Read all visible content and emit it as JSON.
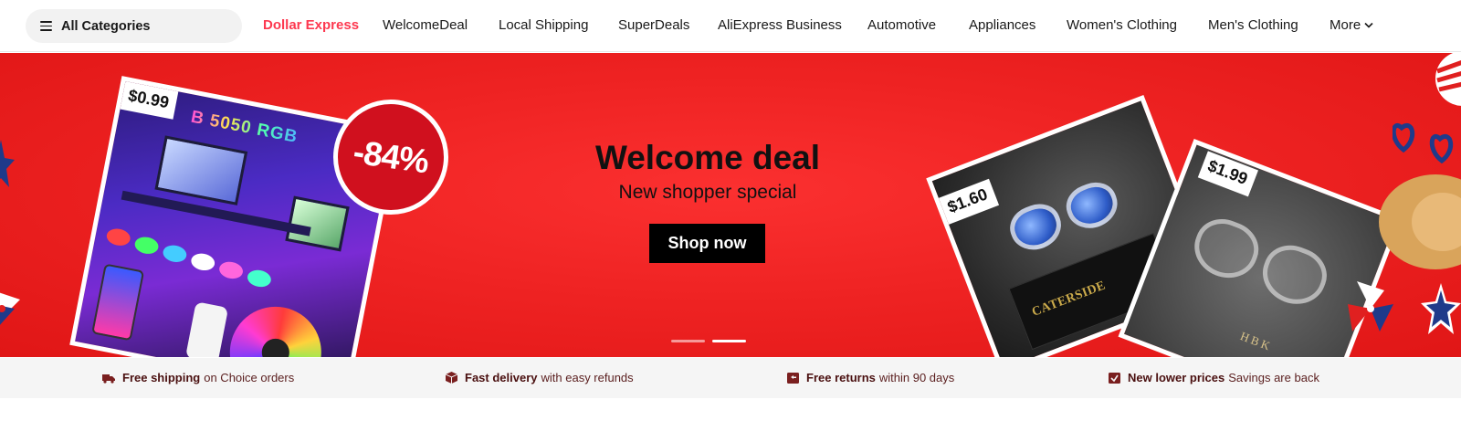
{
  "nav": {
    "categories_label": "All Categories",
    "items": [
      {
        "label": "Dollar Express",
        "highlight": true
      },
      {
        "label": "WelcomeDeal"
      },
      {
        "label": "Local Shipping"
      },
      {
        "label": "SuperDeals"
      },
      {
        "label": "AliExpress Business"
      },
      {
        "label": "Automotive"
      },
      {
        "label": "Appliances"
      },
      {
        "label": "Women's Clothing"
      },
      {
        "label": "Men's Clothing"
      }
    ],
    "more_label": "More",
    "highlight_color": "#fd384f"
  },
  "banner": {
    "title": "Welcome deal",
    "subtitle": "New shopper special",
    "cta_label": "Shop now",
    "background_color": "#ef2323",
    "slides_total": 2,
    "active_slide": 2,
    "products": [
      {
        "price": "$0.99",
        "discount": "-84%",
        "product_text": "B 5050 RGB",
        "product": "rgb-led-strip"
      },
      {
        "price": "$1.60",
        "brand_text": "CATERSIDE",
        "product": "blue-light-glasses"
      },
      {
        "price": "$1.99",
        "brand_text": "HBK",
        "product": "clear-frame-glasses"
      }
    ]
  },
  "benefits": [
    {
      "icon": "truck-icon",
      "bold": "Free shipping",
      "text": "on Choice orders"
    },
    {
      "icon": "package-icon",
      "bold": "Fast delivery",
      "text": "with easy refunds"
    },
    {
      "icon": "return-box-icon",
      "bold": "Free returns",
      "text": "within 90 days"
    },
    {
      "icon": "price-tag-icon",
      "bold": "New lower prices",
      "text": "Savings are back"
    }
  ]
}
